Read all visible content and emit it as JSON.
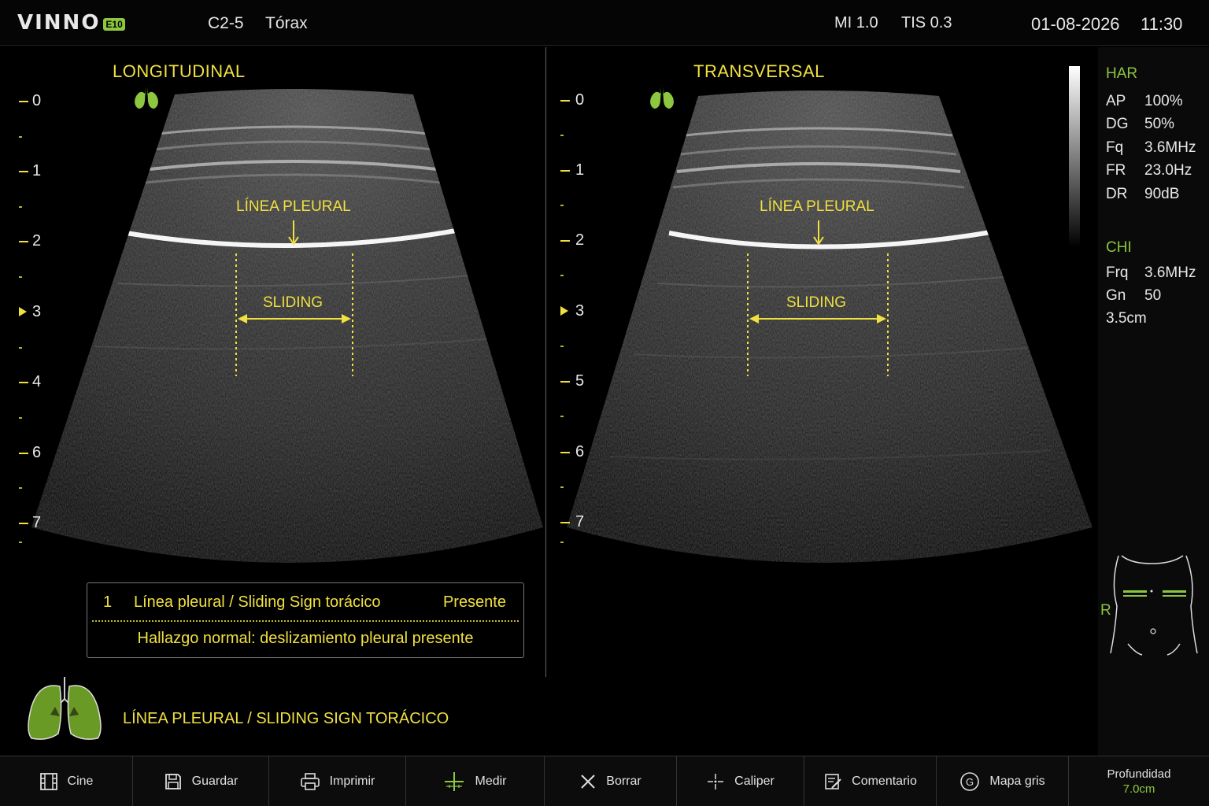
{
  "header": {
    "logo": "VINNO",
    "logo_badge": "E10",
    "probe": "C2-5",
    "preset": "Tórax",
    "mi": "MI 1.0",
    "tis": "TIS 0.3",
    "date": "01-08-2026",
    "time": "11:30"
  },
  "left_view": {
    "title": "LONGITUDINAL",
    "pleural_label": "LÍNEA PLEURAL",
    "sliding_label": "SLIDING",
    "depth_labels": [
      "0",
      "1",
      "2",
      "3",
      "4",
      "6",
      "7"
    ]
  },
  "right_view": {
    "title": "TRANSVERSAL",
    "pleural_label": "LÍNEA PLEURAL",
    "sliding_label": "SLIDING",
    "depth_labels": [
      "0",
      "1",
      "2",
      "3",
      "5",
      "6",
      "7"
    ]
  },
  "params": {
    "har_title": "HAR",
    "har": [
      {
        "label": "AP",
        "value": "100%"
      },
      {
        "label": "DG",
        "value": "50%"
      },
      {
        "label": "Fq",
        "value": "3.6MHz"
      },
      {
        "label": "FR",
        "value": "23.0Hz"
      },
      {
        "label": "DR",
        "value": "90dB"
      }
    ],
    "chi_title": "CHI",
    "chi": [
      {
        "label": "Frq",
        "value": "3.6MHz"
      },
      {
        "label": "Gn",
        "value": "50"
      }
    ],
    "depth_value": "3.5cm",
    "body_marker_side": "R"
  },
  "result": {
    "number": "1",
    "description": "Línea pleural / Sliding Sign torácico",
    "status": "Presente",
    "note": "Hallazgo normal: deslizamiento pleural presente"
  },
  "caption": "LÍNEA PLEURAL / SLIDING SIGN TORÁCICO",
  "toolbar": {
    "cine": "Cine",
    "save": "Guardar",
    "print": "Imprimir",
    "measure": "Medir",
    "erase": "Borrar",
    "caliper": "Caliper",
    "comment": "Comentario",
    "gray_map": "Mapa gris",
    "depth_label": "Profundidad",
    "depth_value": "7.0cm"
  },
  "colors": {
    "accent_yellow": "#f0e040",
    "accent_green": "#8dc63f",
    "background": "#000000"
  }
}
